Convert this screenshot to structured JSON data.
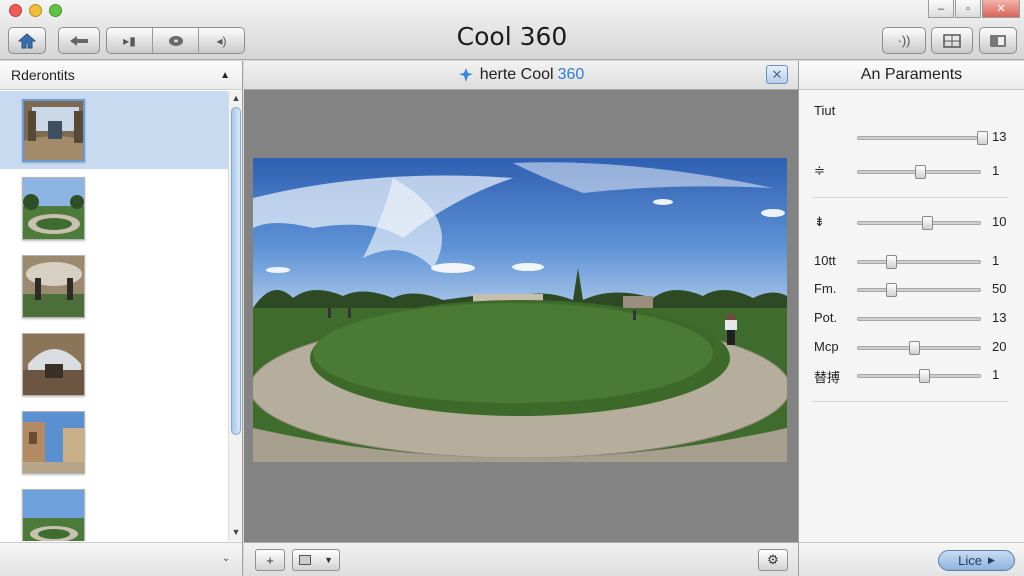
{
  "window": {
    "title": "Cool 360",
    "traffic_colors": [
      "#ee5c58",
      "#f2be3a",
      "#5ec245"
    ]
  },
  "toolbar": {
    "icons": [
      "home-icon",
      "left-arrow-icon",
      "forward-play-icon",
      "disc-icon",
      "speaker-icon",
      "wireless-icon",
      "grid-icon",
      "panel-icon"
    ]
  },
  "left_panel": {
    "title": "Rderontits",
    "thumbnails": [
      {
        "name": "interior-hall"
      },
      {
        "name": "park-path"
      },
      {
        "name": "room-fisheye"
      },
      {
        "name": "arch-hall"
      },
      {
        "name": "building-court"
      },
      {
        "name": "field-sky"
      }
    ],
    "selected_index": 0
  },
  "center_panel": {
    "title_prefix": "herte Cool",
    "title_accent": "360",
    "close_glyph": "✕",
    "footer_add_glyph": "+"
  },
  "right_panel": {
    "title": "An Paraments",
    "params": [
      {
        "label": "Tiut",
        "value": "",
        "level": null
      },
      {
        "label": "",
        "value": "13",
        "level": 1.0
      },
      {
        "label": "≑",
        "value": "1",
        "level": 0.5
      },
      {
        "label": "⇟",
        "value": "10",
        "level": 0.56
      },
      {
        "label": "10tt",
        "value": "1",
        "level": 0.27
      },
      {
        "label": "Fm.",
        "value": "50",
        "level": 0.27
      },
      {
        "label": "Pot.",
        "value": "13",
        "level": null
      },
      {
        "label": "Mcp",
        "value": "20",
        "level": 0.45
      },
      {
        "label": "替搏",
        "value": "1",
        "level": 0.53
      }
    ],
    "live_label": "Lice"
  },
  "accent_color": "#2f7bd4"
}
